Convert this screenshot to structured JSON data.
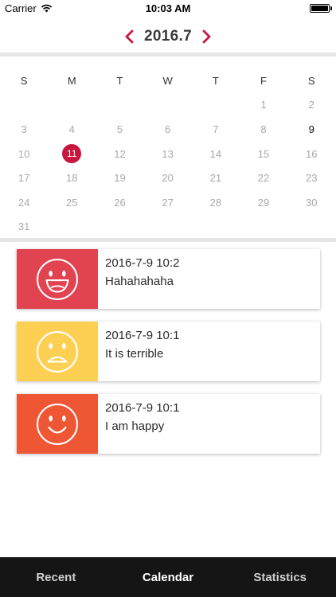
{
  "status_bar": {
    "carrier": "Carrier",
    "time": "10:03 AM"
  },
  "header": {
    "month": "2016.7",
    "prev_icon": "chevron-left-icon",
    "next_icon": "chevron-right-icon",
    "accent": "#c8163f"
  },
  "calendar": {
    "weekdays": [
      "S",
      "M",
      "T",
      "W",
      "T",
      "F",
      "S"
    ],
    "weeks": [
      [
        "",
        "",
        "",
        "",
        "",
        "1",
        "2"
      ],
      [
        "3",
        "4",
        "5",
        "6",
        "7",
        "8",
        "9"
      ],
      [
        "10",
        "11",
        "12",
        "13",
        "14",
        "15",
        "16"
      ],
      [
        "17",
        "18",
        "19",
        "20",
        "21",
        "22",
        "23"
      ],
      [
        "24",
        "25",
        "26",
        "27",
        "28",
        "29",
        "30"
      ],
      [
        "31",
        "",
        "",
        "",
        "",
        "",
        ""
      ]
    ],
    "selected_day": "11",
    "current_day": "9"
  },
  "entries": [
    {
      "timestamp": "2016-7-9 10:2",
      "text": "Hahahahaha",
      "mood_icon": "laughing-face-icon",
      "color": "#e14350"
    },
    {
      "timestamp": "2016-7-9 10:1",
      "text": "It is terrible",
      "mood_icon": "sad-face-icon",
      "color": "#fdd054"
    },
    {
      "timestamp": "2016-7-9 10:1",
      "text": "I am happy",
      "mood_icon": "smiling-face-icon",
      "color": "#ef5734"
    }
  ],
  "tabs": [
    {
      "label": "Recent",
      "active": false
    },
    {
      "label": "Calendar",
      "active": true
    },
    {
      "label": "Statistics",
      "active": false
    }
  ]
}
